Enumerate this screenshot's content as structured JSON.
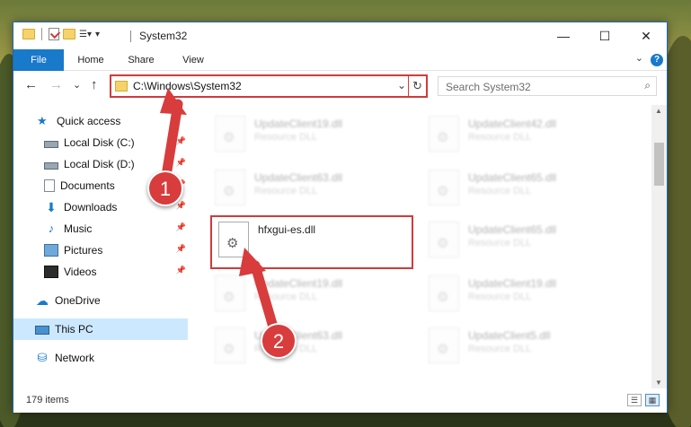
{
  "window": {
    "title": "System32",
    "controls": {
      "minimize": "—",
      "maximize": "☐",
      "close": "✕"
    }
  },
  "ribbon": {
    "tabs": [
      "File",
      "Home",
      "Share",
      "View"
    ],
    "help": "?",
    "collapse": "⌄"
  },
  "navigation": {
    "back": "←",
    "forward": "→",
    "recent": "⌄",
    "up": "↑"
  },
  "address": {
    "path": "C:\\Windows\\System32",
    "dropdown": "⌄",
    "refresh": "↻"
  },
  "search": {
    "placeholder": "Search System32",
    "icon": "⌕"
  },
  "sidebar": {
    "items": [
      {
        "label": "Quick access",
        "icon": "star-icon",
        "pinned": false
      },
      {
        "label": "Local Disk (C:)",
        "icon": "disk-icon",
        "pinned": true
      },
      {
        "label": "Local Disk (D:)",
        "icon": "disk-icon",
        "pinned": true
      },
      {
        "label": "Documents",
        "icon": "documents-icon",
        "pinned": true
      },
      {
        "label": "Downloads",
        "icon": "download-icon",
        "pinned": true
      },
      {
        "label": "Music",
        "icon": "music-icon",
        "pinned": true
      },
      {
        "label": "Pictures",
        "icon": "pictures-icon",
        "pinned": true
      },
      {
        "label": "Videos",
        "icon": "videos-icon",
        "pinned": true
      },
      {
        "label": "OneDrive",
        "icon": "cloud-icon",
        "pinned": false
      },
      {
        "label": "This PC",
        "icon": "pc-icon",
        "pinned": false,
        "selected": true
      },
      {
        "label": "Network",
        "icon": "network-icon",
        "pinned": false
      }
    ]
  },
  "files": [
    {
      "name": "UpdateClient19.dll",
      "type": "Resource DLL"
    },
    {
      "name": "UpdateClient42.dll",
      "type": "Resource DLL"
    },
    {
      "name": "UpdateClient63.dll",
      "type": "Resource DLL"
    },
    {
      "name": "UpdateClient65.dll",
      "type": "Resource DLL"
    },
    {
      "name": "hfxgui-es.dll",
      "type": "",
      "highlighted": true
    },
    {
      "name": "UpdateClient65.dll",
      "type": "Resource DLL"
    },
    {
      "name": "UpdateClient19.dll",
      "type": "Resource DLL"
    },
    {
      "name": "UpdateClient19.dll",
      "type": "Resource DLL"
    },
    {
      "name": "UpdateClient63.dll",
      "type": "Resource DLL"
    },
    {
      "name": "UpdateClient5.dll",
      "type": "Resource DLL"
    }
  ],
  "status": {
    "count": "179 items"
  },
  "annotations": {
    "step1": "1",
    "step2": "2"
  },
  "colors": {
    "accent": "#1979ca",
    "highlight": "#d33a3a",
    "selected": "#cce8ff"
  }
}
